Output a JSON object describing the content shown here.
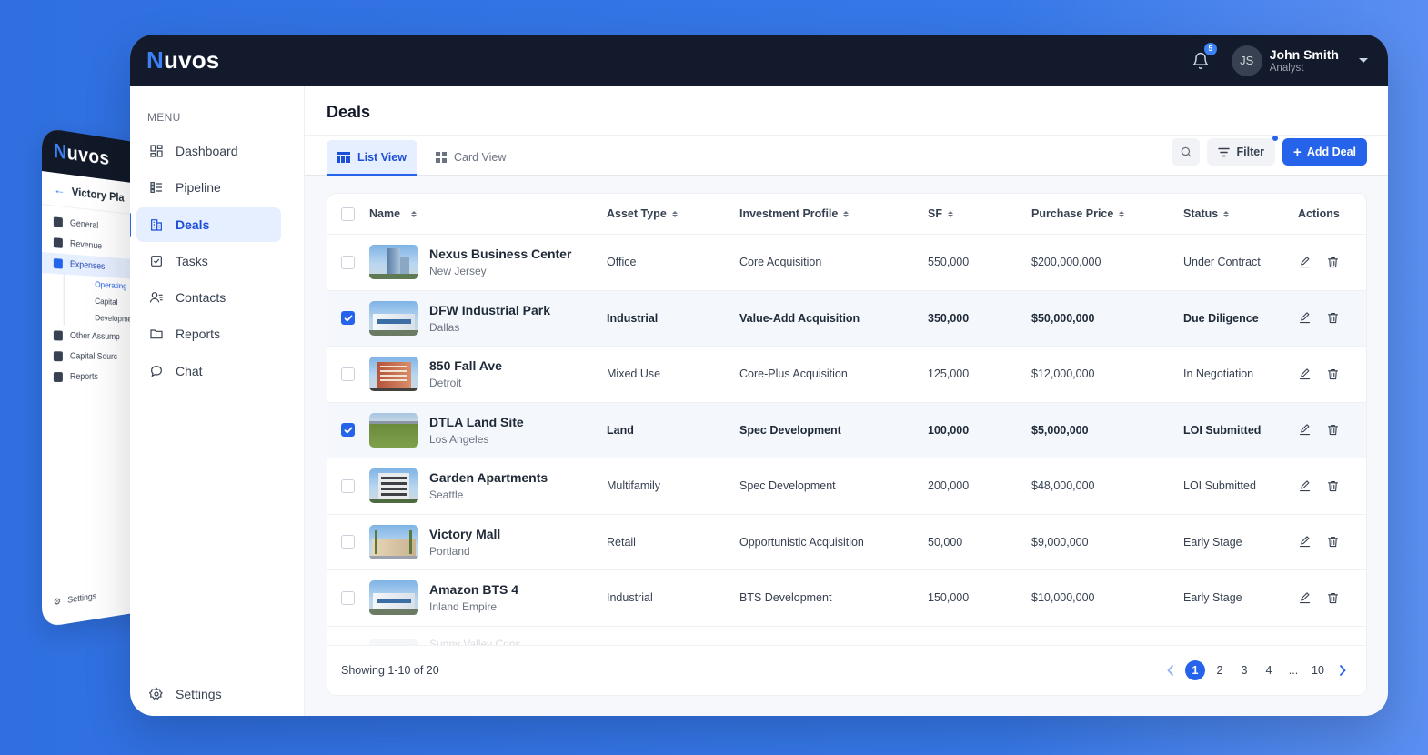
{
  "back_card": {
    "logo_n": "N",
    "logo_rest": "uvos",
    "title": "Victory Pla",
    "items": [
      {
        "label": "General",
        "icon": "home-icon"
      },
      {
        "label": "Revenue",
        "icon": "people-icon"
      },
      {
        "label": "Expenses",
        "icon": "wallet-icon",
        "active": true
      }
    ],
    "subitems": [
      {
        "label": "Operating",
        "active": true
      },
      {
        "label": "Capital"
      },
      {
        "label": "Development"
      }
    ],
    "items2": [
      {
        "label": "Other Assump",
        "icon": "bulb-icon"
      },
      {
        "label": "Capital Sourc",
        "icon": "bank-icon"
      },
      {
        "label": "Reports",
        "icon": "report-icon"
      }
    ],
    "settings": "Settings"
  },
  "header": {
    "logo_n": "N",
    "logo_rest": "uvos",
    "notifications": "5",
    "user_initials": "JS",
    "user_name": "John Smith",
    "user_role": "Analyst"
  },
  "sidebar": {
    "menu_label": "MENU",
    "items": [
      {
        "label": "Dashboard",
        "icon": "dashboard-icon"
      },
      {
        "label": "Pipeline",
        "icon": "pipeline-icon"
      },
      {
        "label": "Deals",
        "icon": "building-icon",
        "active": true
      },
      {
        "label": "Tasks",
        "icon": "checkbox-icon"
      },
      {
        "label": "Contacts",
        "icon": "contacts-icon"
      },
      {
        "label": "Reports",
        "icon": "folder-icon"
      },
      {
        "label": "Chat",
        "icon": "chat-icon"
      }
    ],
    "settings": "Settings"
  },
  "page": {
    "title": "Deals",
    "tabs": [
      {
        "label": "List View",
        "active": true
      },
      {
        "label": "Card View"
      }
    ],
    "filter_label": "Filter",
    "add_label": "Add Deal"
  },
  "table": {
    "columns": [
      "Name",
      "Asset Type",
      "Investment Profile",
      "SF",
      "Purchase Price",
      "Status",
      "Actions"
    ],
    "rows": [
      {
        "name": "Nexus Business Center",
        "location": "New Jersey",
        "asset": "Office",
        "profile": "Core Acquisition",
        "sf": "550,000",
        "price": "$200,000,000",
        "status": "Under Contract",
        "selected": false,
        "thumb": "office"
      },
      {
        "name": "DFW Industrial Park",
        "location": "Dallas",
        "asset": "Industrial",
        "profile": "Value-Add Acquisition",
        "sf": "350,000",
        "price": "$50,000,000",
        "status": "Due Diligence",
        "selected": true,
        "thumb": "industrial"
      },
      {
        "name": "850 Fall Ave",
        "location": "Detroit",
        "asset": "Mixed Use",
        "profile": "Core-Plus Acquisition",
        "sf": "125,000",
        "price": "$12,000,000",
        "status": "In Negotiation",
        "selected": false,
        "thumb": "mixed"
      },
      {
        "name": "DTLA Land Site",
        "location": "Los Angeles",
        "asset": "Land",
        "profile": "Spec Development",
        "sf": "100,000",
        "price": "$5,000,000",
        "status": "LOI Submitted",
        "selected": true,
        "thumb": "land"
      },
      {
        "name": "Garden Apartments",
        "location": "Seattle",
        "asset": "Multifamily",
        "profile": "Spec Development",
        "sf": "200,000",
        "price": "$48,000,000",
        "status": "LOI Submitted",
        "selected": false,
        "thumb": "apartments"
      },
      {
        "name": "Victory Mall",
        "location": "Portland",
        "asset": "Retail",
        "profile": "Opportunistic Acquisition",
        "sf": "50,000",
        "price": "$9,000,000",
        "status": "Early Stage",
        "selected": false,
        "thumb": "mall"
      },
      {
        "name": "Amazon BTS 4",
        "location": "Inland Empire",
        "asset": "Industrial",
        "profile": "BTS Development",
        "sf": "150,000",
        "price": "$10,000,000",
        "status": "Early Stage",
        "selected": false,
        "thumb": "industrial2"
      }
    ],
    "ghost_row": "Sunny Valley Cons...",
    "showing": "Showing 1-10 of 20",
    "pages": [
      "1",
      "2",
      "3",
      "4",
      "...",
      "10"
    ]
  },
  "colors": {
    "accent": "#2563eb",
    "topbar": "#121a2b",
    "background": "#2f6fe0"
  }
}
